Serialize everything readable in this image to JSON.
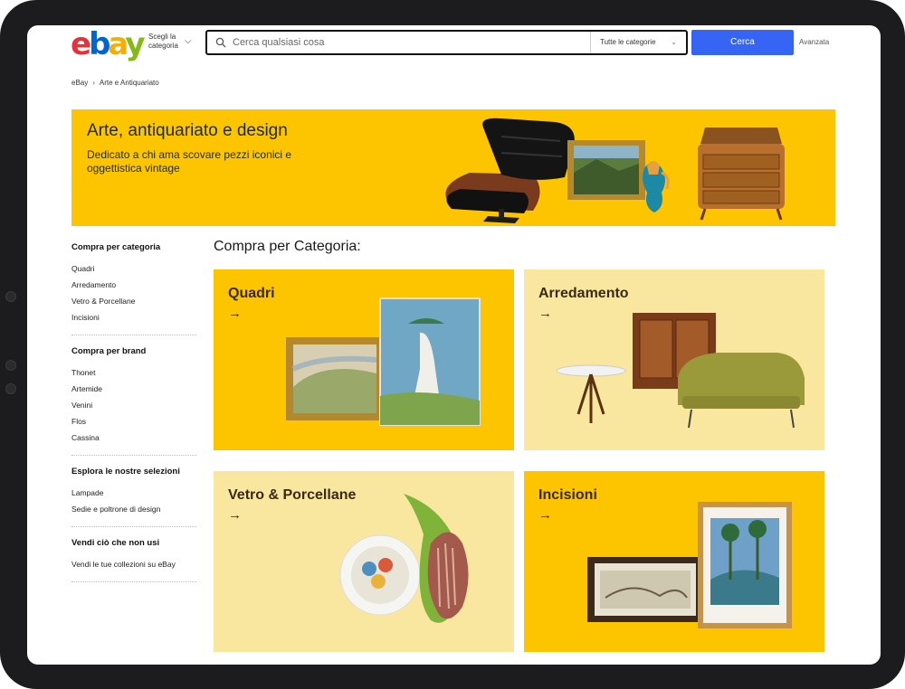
{
  "header": {
    "logo": {
      "e": "e",
      "b": "b",
      "a": "a",
      "y": "y"
    },
    "shop_by_category": "Scegli la categoria",
    "search_placeholder": "Cerca qualsiasi cosa",
    "search_category": "Tutte le categorie",
    "search_button": "Cerca",
    "advanced": "Avanzata"
  },
  "breadcrumb": [
    "eBay",
    "Arte e Antiquariato"
  ],
  "hero": {
    "title": "Arte, antiquariato e design",
    "subtitle": "Dedicato a chi ama scovare pezzi iconici e oggettistica vintage"
  },
  "sidebar": {
    "groups": [
      {
        "heading": "Compra per categoria",
        "links": [
          "Quadri",
          "Arredamento",
          "Vetro & Porcellane",
          "Incisioni"
        ]
      },
      {
        "heading": "Compra per brand",
        "links": [
          "Thonet",
          "Artemide",
          "Venini",
          "Flos",
          "Cassina"
        ]
      },
      {
        "heading": "Esplora le nostre selezioni",
        "links": [
          "Lampade",
          "Sedie e poltrone di design"
        ]
      },
      {
        "heading": "Vendi ciò che non usi",
        "links": [
          "Vendi le tue collezioni su eBay"
        ]
      }
    ]
  },
  "categories": {
    "title": "Compra per Categoria:",
    "arrow": "→",
    "cards": [
      {
        "label": "Quadri"
      },
      {
        "label": "Arredamento"
      },
      {
        "label": "Vetro & Porcellane"
      },
      {
        "label": "Incisioni"
      }
    ]
  },
  "colors": {
    "accent": "#3665f3",
    "hero_bg": "#fdc500",
    "card_light": "#f9e79f"
  }
}
